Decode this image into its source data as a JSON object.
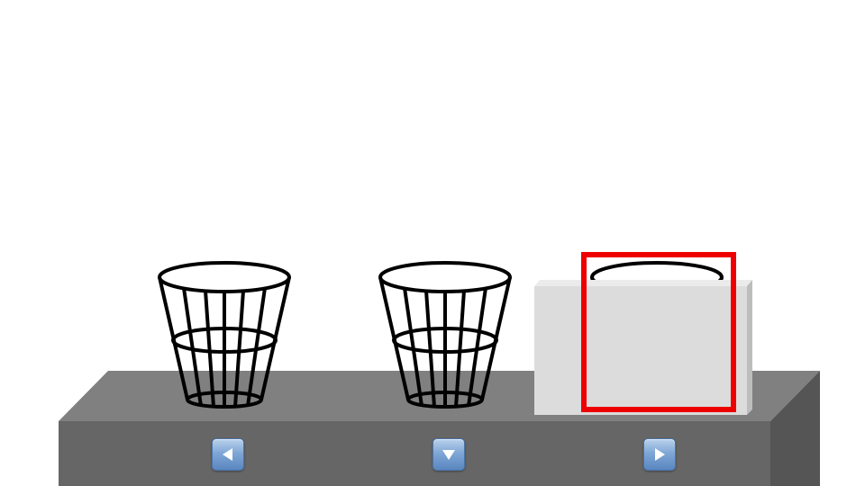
{
  "scene": {
    "baskets": [
      {
        "name": "basket-1",
        "icon": "wire-basket"
      },
      {
        "name": "basket-2",
        "icon": "wire-basket"
      },
      {
        "name": "basket-3",
        "icon": "wire-basket",
        "covered": true
      }
    ],
    "cover_box": {
      "color": "#dcdcdc"
    },
    "selection": {
      "target": "basket-3",
      "color": "#ee0000"
    },
    "table": {
      "top_color": "#808080",
      "front_color": "#666666",
      "side_color": "#555555"
    }
  },
  "controls": {
    "left": {
      "icon": "arrow-left-icon"
    },
    "down": {
      "icon": "arrow-down-icon"
    },
    "right": {
      "icon": "arrow-right-icon"
    },
    "button_color": "#7fa7d6"
  }
}
